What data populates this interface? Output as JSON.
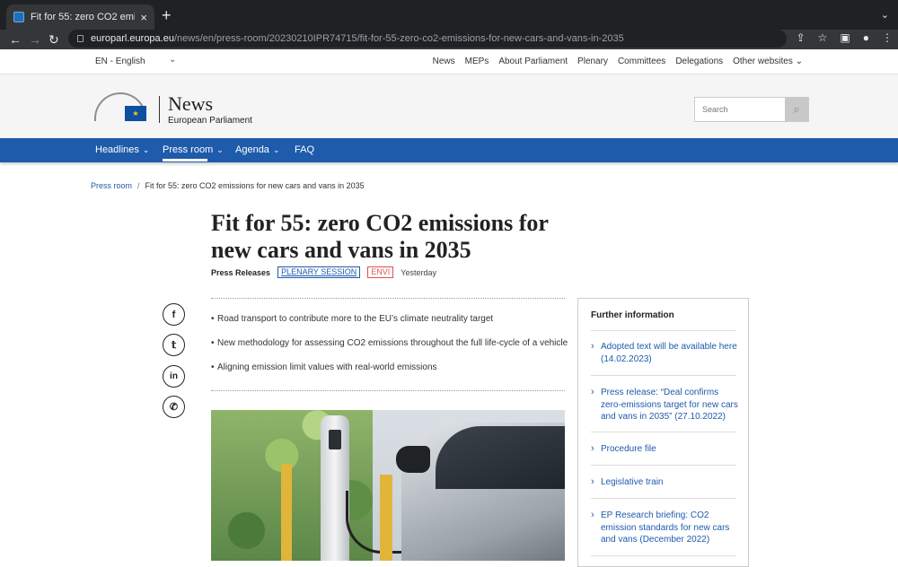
{
  "browser": {
    "tab_title": "Fit for 55: zero CO2 emissions",
    "tab_close": "×",
    "new_tab": "+",
    "url_host": "europarl.europa.eu",
    "url_path": "/news/en/press-room/20230210IPR74715/fit-for-55-zero-co2-emissions-for-new-cars-and-vans-in-2035"
  },
  "site_top": {
    "language": "EN - English",
    "links": [
      "News",
      "MEPs",
      "About Parliament",
      "Plenary",
      "Committees",
      "Delegations",
      "Other websites"
    ]
  },
  "header": {
    "title": "News",
    "subtitle": "European Parliament",
    "search_placeholder": "Search"
  },
  "nav": {
    "items": [
      "Headlines",
      "Press room",
      "Agenda",
      "FAQ"
    ],
    "active": "Press room"
  },
  "breadcrumb": {
    "root": "Press room",
    "sep": "/",
    "current": "Fit for 55: zero CO2 emissions for new cars and vans in 2035"
  },
  "article": {
    "title": "Fit for 55: zero CO2 emissions for new cars and vans in 2035",
    "type": "Press Releases",
    "tag_plenary": "PLENARY SESSION",
    "tag_envi": "ENVI",
    "date": "Yesterday",
    "bullets": [
      "Road transport to contribute more to the EU’s climate neutrality target",
      "New methodology for assessing CO2 emissions throughout the full life-cycle of a vehicle",
      "Aligning emission limit values with real-world emissions"
    ]
  },
  "share": {
    "icons": [
      "facebook-icon",
      "twitter-icon",
      "linkedin-icon",
      "whatsapp-icon"
    ]
  },
  "sidebar": {
    "title": "Further information",
    "links": [
      "Adopted text will be available here (14.02.2023)",
      "Press release: “Deal confirms zero-emissions target for new cars and vans in 2035” (27.10.2022)",
      "Procedure file",
      "Legislative train",
      "EP Research briefing: CO2 emission standards for new cars and vans (December 2022)"
    ]
  },
  "colors": {
    "nav_blue": "#1e5bab",
    "envi_red": "#d9534f"
  }
}
